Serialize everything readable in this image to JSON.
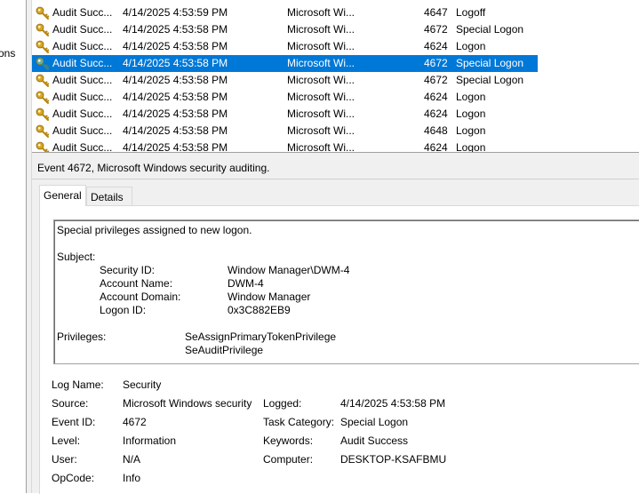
{
  "left_pane": {
    "partial_label": "ons"
  },
  "event_list": {
    "rows": [
      {
        "level": "Audit Succ...",
        "date": "4/14/2025 4:53:59 PM",
        "source": "Microsoft Wi...",
        "event_id": "4647",
        "task": "Logoff",
        "selected": false
      },
      {
        "level": "Audit Succ...",
        "date": "4/14/2025 4:53:58 PM",
        "source": "Microsoft Wi...",
        "event_id": "4672",
        "task": "Special Logon",
        "selected": false
      },
      {
        "level": "Audit Succ...",
        "date": "4/14/2025 4:53:58 PM",
        "source": "Microsoft Wi...",
        "event_id": "4624",
        "task": "Logon",
        "selected": false
      },
      {
        "level": "Audit Succ...",
        "date": "4/14/2025 4:53:58 PM",
        "source": "Microsoft Wi...",
        "event_id": "4672",
        "task": "Special Logon",
        "selected": true
      },
      {
        "level": "Audit Succ...",
        "date": "4/14/2025 4:53:58 PM",
        "source": "Microsoft Wi...",
        "event_id": "4672",
        "task": "Special Logon",
        "selected": false
      },
      {
        "level": "Audit Succ...",
        "date": "4/14/2025 4:53:58 PM",
        "source": "Microsoft Wi...",
        "event_id": "4624",
        "task": "Logon",
        "selected": false
      },
      {
        "level": "Audit Succ...",
        "date": "4/14/2025 4:53:58 PM",
        "source": "Microsoft Wi...",
        "event_id": "4624",
        "task": "Logon",
        "selected": false
      },
      {
        "level": "Audit Succ...",
        "date": "4/14/2025 4:53:58 PM",
        "source": "Microsoft Wi...",
        "event_id": "4648",
        "task": "Logon",
        "selected": false
      },
      {
        "level": "Audit Succ...",
        "date": "4/14/2025 4:53:58 PM",
        "source": "Microsoft Wi...",
        "event_id": "4624",
        "task": "Logon",
        "selected": false
      }
    ],
    "row_icon": "key-icon"
  },
  "detail": {
    "title": "Event 4672, Microsoft Windows security auditing.",
    "tabs": {
      "general": "General",
      "details": "Details"
    },
    "description": {
      "headline": "Special privileges assigned to new logon.",
      "subject_label": "Subject:",
      "subject": {
        "security_id_label": "Security ID:",
        "security_id": "Window Manager\\DWM-4",
        "account_name_label": "Account Name:",
        "account_name": "DWM-4",
        "account_domain_label": "Account Domain:",
        "account_domain": "Window Manager",
        "logon_id_label": "Logon ID:",
        "logon_id": "0x3C882EB9"
      },
      "privileges_label": "Privileges:",
      "privileges": [
        "SeAssignPrimaryTokenPrivilege",
        "SeAuditPrivilege"
      ]
    },
    "properties": {
      "log_name_label": "Log Name:",
      "log_name": "Security",
      "source_label": "Source:",
      "source": "Microsoft Windows security",
      "logged_label": "Logged:",
      "logged": "4/14/2025 4:53:58 PM",
      "event_id_label": "Event ID:",
      "event_id": "4672",
      "task_category_label": "Task Category:",
      "task_category": "Special Logon",
      "level_label": "Level:",
      "level": "Information",
      "keywords_label": "Keywords:",
      "keywords": "Audit Success",
      "user_label": "User:",
      "user": "N/A",
      "computer_label": "Computer:",
      "computer": "DESKTOP-KSAFBMU",
      "opcode_label": "OpCode:",
      "opcode": "Info"
    }
  },
  "colors": {
    "selection": "#0078d7",
    "pane_bg": "#f0f0f0",
    "key_gold": "#d9a520"
  }
}
